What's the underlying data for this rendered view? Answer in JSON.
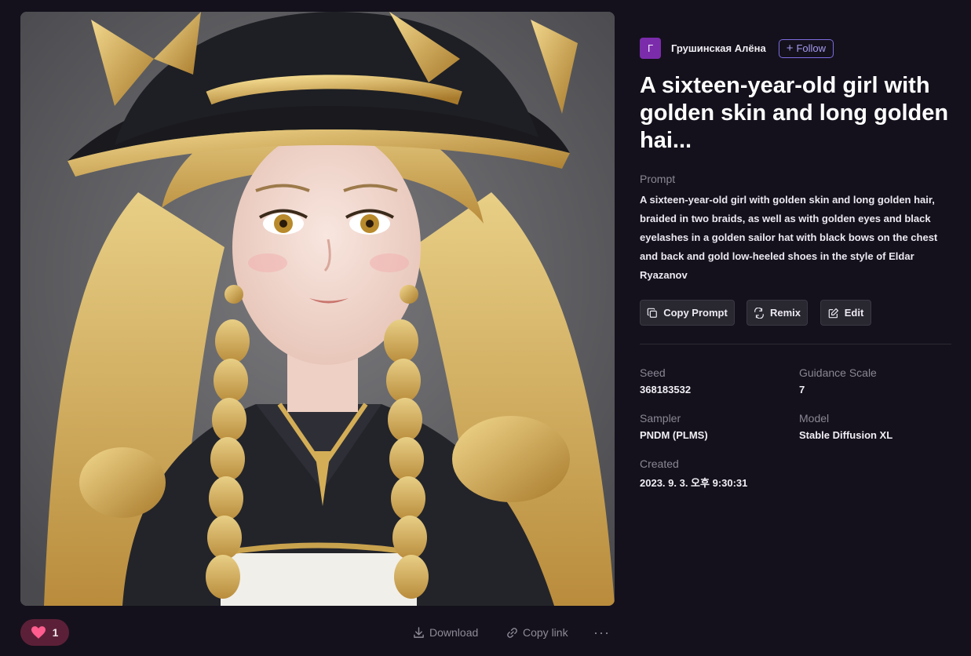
{
  "author": {
    "avatar_letter": "Г",
    "name": "Грушинская Алёна",
    "follow_label": "Follow"
  },
  "title": "A sixteen-year-old girl with golden skin and long golden hai...",
  "prompt": {
    "label": "Prompt",
    "text": "A sixteen-year-old girl with golden skin and long golden hair, braided in two braids, as well as with golden eyes and black eyelashes in a golden sailor hat with black bows on the chest and back and gold low-heeled shoes in the style of Eldar Ryazanov"
  },
  "buttons": {
    "copy_prompt": "Copy Prompt",
    "remix": "Remix",
    "edit": "Edit"
  },
  "details": {
    "seed_label": "Seed",
    "seed": "368183532",
    "guidance_label": "Guidance Scale",
    "guidance": "7",
    "sampler_label": "Sampler",
    "sampler": "PNDM (PLMS)",
    "model_label": "Model",
    "model": "Stable Diffusion XL",
    "created_label": "Created",
    "created": "2023. 9. 3. 오후 9:30:31"
  },
  "actions": {
    "like_count": "1",
    "download": "Download",
    "copy_link": "Copy link",
    "more": "···"
  },
  "colors": {
    "background": "#14111c",
    "accent": "#7d6ce0",
    "like_pill": "#5b2037",
    "heart": "#ff5d8f",
    "avatar": "#7b2cab"
  },
  "icons": {
    "heart": "heart-icon",
    "download": "download-icon",
    "link": "link-icon",
    "copy": "copy-icon",
    "remix": "remix-icon",
    "edit": "edit-icon",
    "more": "more-icon"
  }
}
